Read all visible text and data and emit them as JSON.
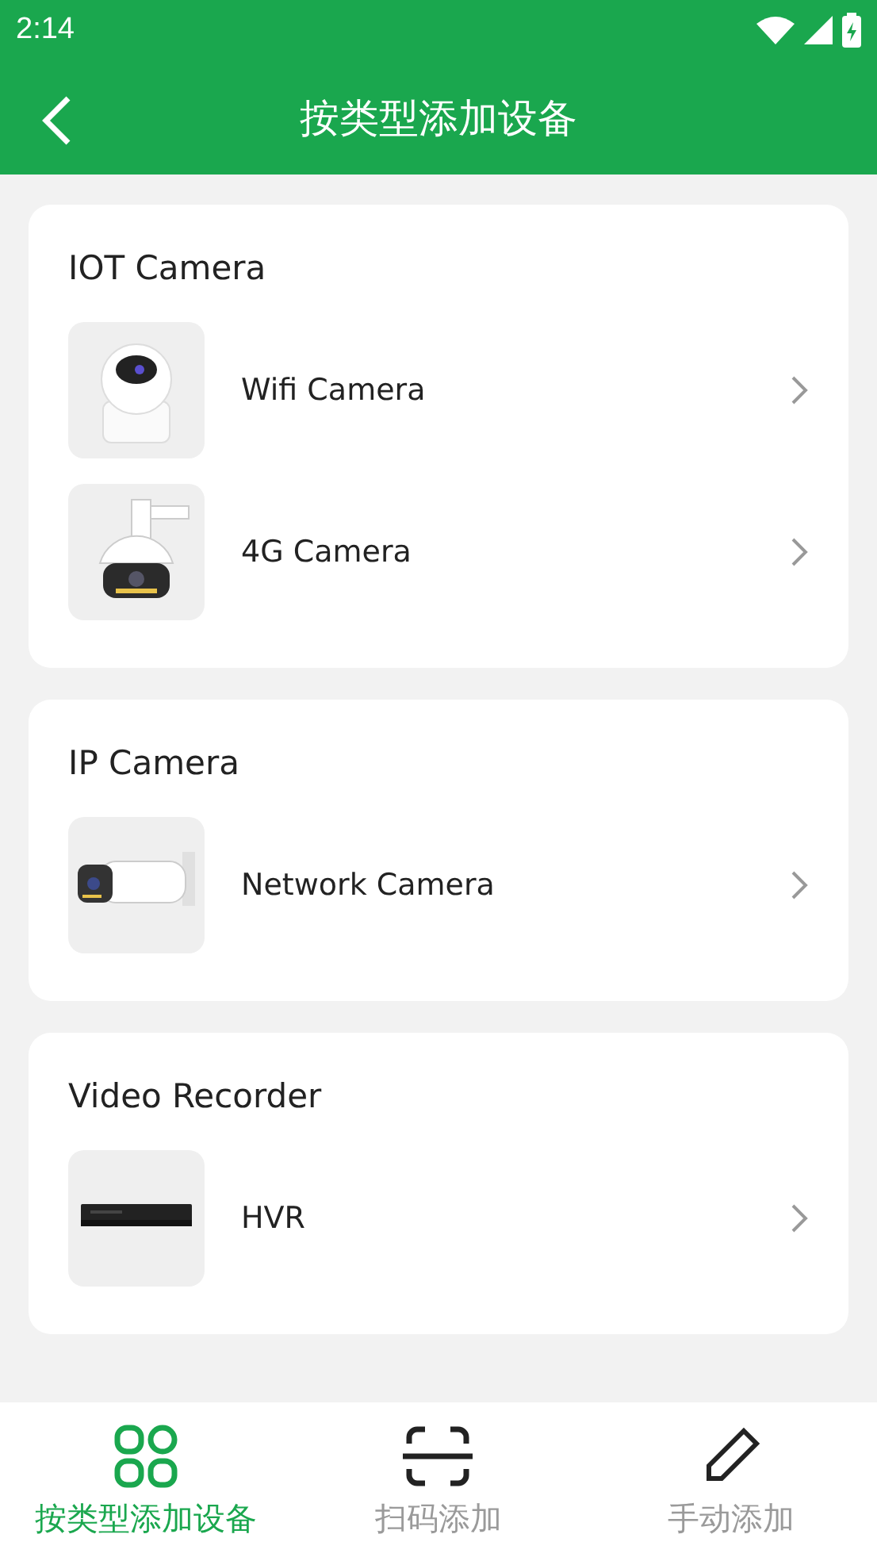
{
  "status_bar": {
    "time": "2:14"
  },
  "header": {
    "title": "按类型添加设备"
  },
  "sections": [
    {
      "title": "IOT Camera",
      "items": [
        {
          "label": "Wifi Camera",
          "kind": "picture"
        },
        {
          "label": "4G Camera",
          "kind": "picture"
        }
      ]
    },
    {
      "title": "IP Camera",
      "items": [
        {
          "label": "Network Camera",
          "kind": "picture"
        }
      ]
    },
    {
      "title": "Video Recorder",
      "items": [
        {
          "label": "HVR",
          "kind": "picture"
        }
      ]
    }
  ],
  "tabs": [
    {
      "label": "按类型添加设备",
      "kind": "grid",
      "selected": true
    },
    {
      "label": "扫码添加",
      "kind": "scan",
      "selected": false
    },
    {
      "label": "手动添加",
      "kind": "pencil",
      "selected": false
    }
  ]
}
